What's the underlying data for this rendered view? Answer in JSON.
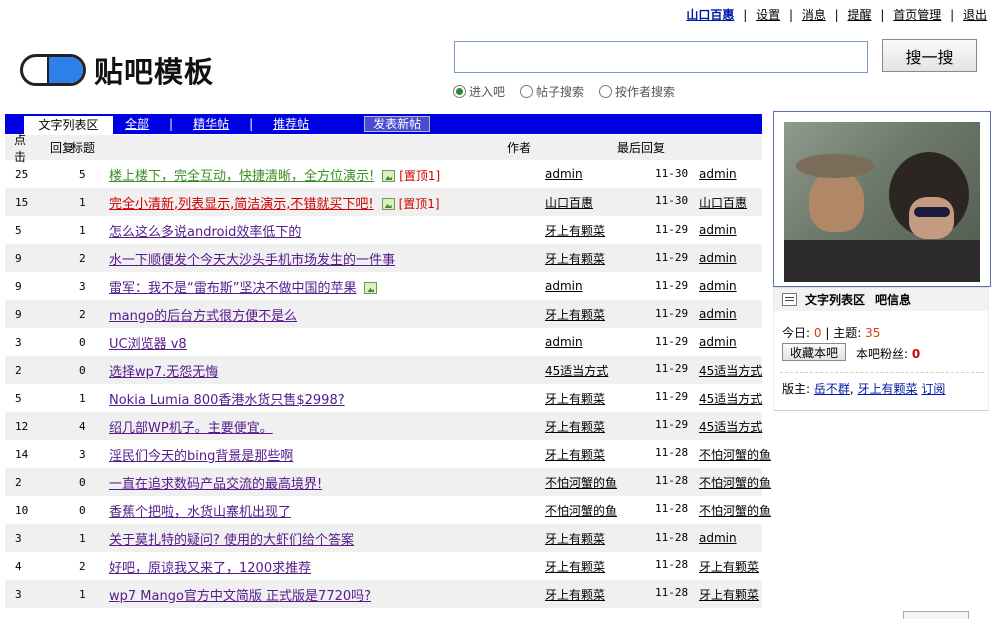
{
  "topnav": {
    "user": "山口百惠",
    "links": [
      "设置",
      "消息",
      "提醒",
      "首页管理",
      "退出"
    ]
  },
  "logo": {
    "title": "贴吧模板"
  },
  "search": {
    "value": "",
    "button_label": "搜一搜",
    "options": [
      {
        "label": "进入吧",
        "selected": true
      },
      {
        "label": "帖子搜索",
        "selected": false
      },
      {
        "label": "按作者搜索",
        "selected": false
      }
    ]
  },
  "tabs": {
    "active": "文字列表区",
    "items": [
      "全部",
      "精华帖",
      "推荐帖"
    ],
    "new_post_label": "发表新帖",
    "bar_color": "#0000e4"
  },
  "table": {
    "headers": {
      "clicks": "点击",
      "replies": "回复",
      "title": "标题",
      "author": "作者",
      "last_reply": "最后回复"
    },
    "rows": [
      {
        "clicks": "25",
        "replies": "5",
        "title": "楼上楼下，完全互动，快捷清晰，全方位演示!",
        "style": "green",
        "has_image": true,
        "pin": "[置顶1]",
        "author": "admin",
        "date": "11-30",
        "last_user": "admin"
      },
      {
        "clicks": "15",
        "replies": "1",
        "title": "完全小清新,列表显示,简洁演示,不错就买下吧!",
        "style": "red",
        "has_image": true,
        "pin": "[置顶1]",
        "author": "山口百惠",
        "date": "11-30",
        "last_user": "山口百惠"
      },
      {
        "clicks": "5",
        "replies": "1",
        "title": "怎么这么多说android效率低下的",
        "style": "",
        "has_image": false,
        "pin": "",
        "author": "牙上有颗菜",
        "date": "11-29",
        "last_user": "admin"
      },
      {
        "clicks": "9",
        "replies": "2",
        "title": "水一下顺便发个今天大沙头手机市场发生的一件事",
        "style": "",
        "has_image": false,
        "pin": "",
        "author": "牙上有颗菜",
        "date": "11-29",
        "last_user": "admin"
      },
      {
        "clicks": "9",
        "replies": "3",
        "title": "雷军：我不是“雷布斯”坚决不做中国的苹果",
        "style": "",
        "has_image": true,
        "pin": "",
        "author": "admin",
        "date": "11-29",
        "last_user": "admin"
      },
      {
        "clicks": "9",
        "replies": "2",
        "title": "mango的后台方式很方便不是么",
        "style": "",
        "has_image": false,
        "pin": "",
        "author": "牙上有颗菜",
        "date": "11-29",
        "last_user": "admin"
      },
      {
        "clicks": "3",
        "replies": "0",
        "title": "UC浏览器 v8",
        "style": "",
        "has_image": false,
        "pin": "",
        "author": "admin",
        "date": "11-29",
        "last_user": "admin"
      },
      {
        "clicks": "2",
        "replies": "0",
        "title": "选择wp7.无怨无悔",
        "style": "",
        "has_image": false,
        "pin": "",
        "author": "45适当方式",
        "date": "11-29",
        "last_user": "45适当方式"
      },
      {
        "clicks": "5",
        "replies": "1",
        "title": "Nokia Lumia 800香港水货只售$2998?",
        "style": "",
        "has_image": false,
        "pin": "",
        "author": "牙上有颗菜",
        "date": "11-29",
        "last_user": "45适当方式"
      },
      {
        "clicks": "12",
        "replies": "4",
        "title": "绍几部WP机子。主要便宜。",
        "style": "",
        "has_image": false,
        "pin": "",
        "author": "牙上有颗菜",
        "date": "11-29",
        "last_user": "45适当方式"
      },
      {
        "clicks": "14",
        "replies": "3",
        "title": "淫民们今天的bing背景是那些啊",
        "style": "",
        "has_image": false,
        "pin": "",
        "author": "牙上有颗菜",
        "date": "11-28",
        "last_user": "不怕河蟹的鱼"
      },
      {
        "clicks": "2",
        "replies": "0",
        "title": "一直在追求数码产品交流的最高境界!",
        "style": "",
        "has_image": false,
        "pin": "",
        "author": "不怕河蟹的鱼",
        "date": "11-28",
        "last_user": "不怕河蟹的鱼"
      },
      {
        "clicks": "10",
        "replies": "0",
        "title": "香蕉个把啦，水货山寨机出现了",
        "style": "",
        "has_image": false,
        "pin": "",
        "author": "不怕河蟹的鱼",
        "date": "11-28",
        "last_user": "不怕河蟹的鱼"
      },
      {
        "clicks": "3",
        "replies": "1",
        "title": "关于莫扎特的疑问? 使用的大虾们给个答案",
        "style": "",
        "has_image": false,
        "pin": "",
        "author": "牙上有颗菜",
        "date": "11-28",
        "last_user": "admin"
      },
      {
        "clicks": "4",
        "replies": "2",
        "title": "好吧，原谅我又来了，1200求推荐",
        "style": "",
        "has_image": false,
        "pin": "",
        "author": "牙上有颗菜",
        "date": "11-28",
        "last_user": "牙上有颗菜"
      },
      {
        "clicks": "3",
        "replies": "1",
        "title": "wp7 Mango官方中文简版 正式版是7720吗?",
        "style": "",
        "has_image": false,
        "pin": "",
        "author": "牙上有颗菜",
        "date": "11-28",
        "last_user": "牙上有颗菜"
      }
    ]
  },
  "sidebar": {
    "board_name": "文字列表区",
    "info_label": "吧信息",
    "today_label": "今日:",
    "today_value": "0",
    "topics_label": "主题:",
    "topics_value": "35",
    "fav_button": "收藏本吧",
    "fans_label": "本吧粉丝:",
    "fans_value": "0",
    "admins_label": "版主:",
    "admins": [
      "岳不群",
      "牙上有颗菜"
    ],
    "subscribe": "订阅"
  }
}
